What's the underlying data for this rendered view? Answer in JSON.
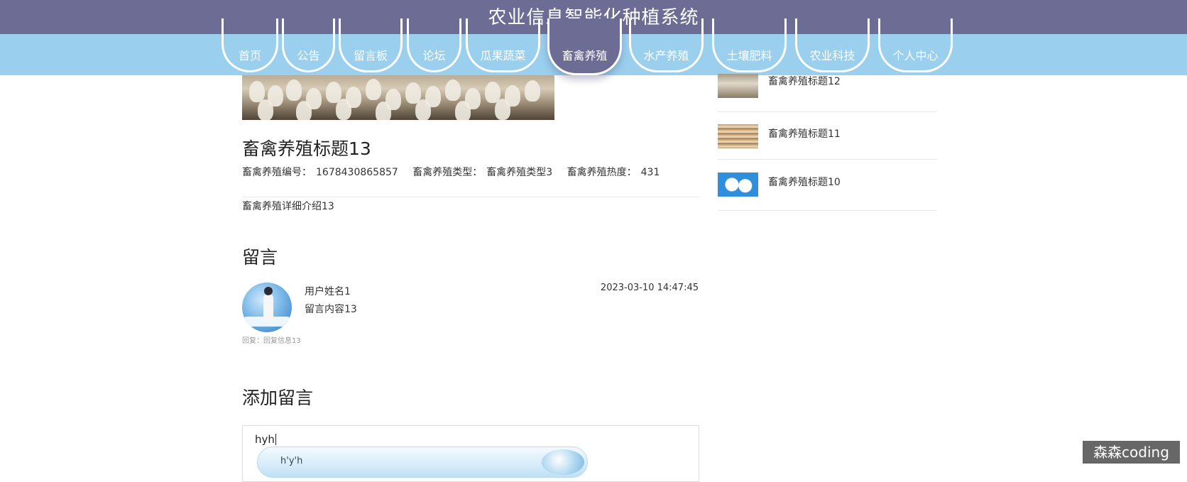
{
  "header": {
    "site_title": "农业信息智能化种植系统"
  },
  "nav": {
    "items": [
      {
        "label": "首页"
      },
      {
        "label": "公告"
      },
      {
        "label": "留言板"
      },
      {
        "label": "论坛"
      },
      {
        "label": "瓜果蔬菜"
      },
      {
        "label": "畜禽养殖"
      },
      {
        "label": "水产养殖"
      },
      {
        "label": "土壤肥料"
      },
      {
        "label": "农业科技"
      },
      {
        "label": "个人中心"
      }
    ],
    "active": "畜禽养殖"
  },
  "detail": {
    "title": "畜禽养殖标题13",
    "number_label": "畜禽养殖编号：",
    "number_value": "1678430865857",
    "type_label": "畜禽养殖类型：",
    "type_value": "畜禽养殖类型3",
    "heat_label": "畜禽养殖热度：",
    "heat_value": "431",
    "intro": "畜禽养殖详细介绍13"
  },
  "comments": {
    "section_title": "留言",
    "items": [
      {
        "username": "用户姓名1",
        "content": "留言内容13",
        "date": "2023-03-10 14:47:45",
        "reply": "回复：回复信息13"
      }
    ]
  },
  "add_comment": {
    "section_title": "添加留言",
    "input_text": "hyh",
    "ime_composition": "h'y'h"
  },
  "sidebar": {
    "items": [
      {
        "title": "畜禽养殖标题12"
      },
      {
        "title": "畜禽养殖标题11"
      },
      {
        "title": "畜禽养殖标题10"
      }
    ]
  },
  "watermark": "森森coding"
}
